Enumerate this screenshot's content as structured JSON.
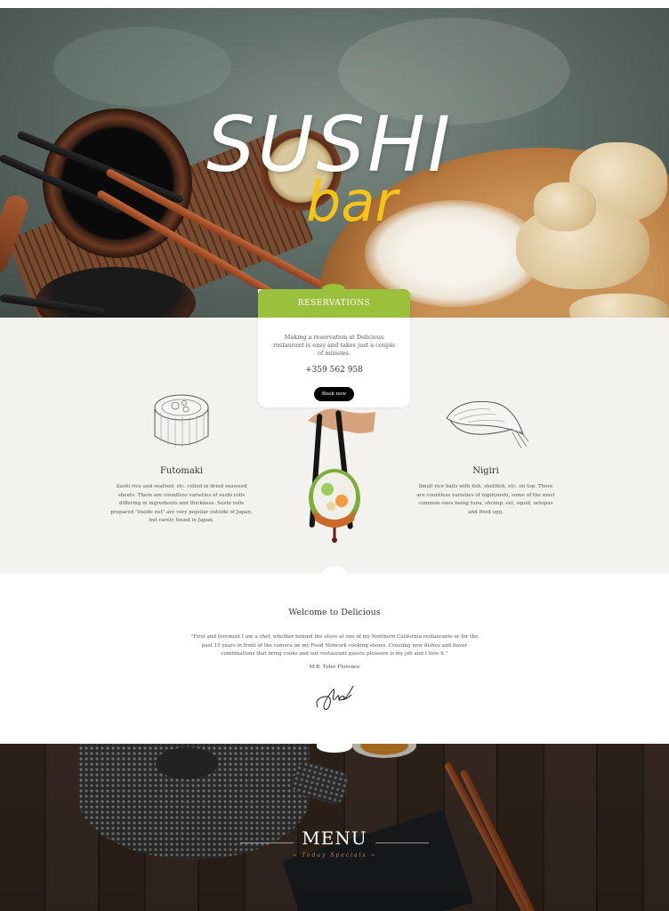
{
  "hero": {
    "logo_top": "SUSHI",
    "logo_bottom": "bar"
  },
  "reservations": {
    "title": "RESERVATIONS",
    "text": "Making a reservation at Delicious restaurant is easy and takes just a couple of minutes.",
    "phone": "+359 562 958",
    "button_label": "Book now"
  },
  "features": [
    {
      "title": "Futomaki",
      "text": "Sushi rice and seafood, etc. rolled in dried seaweed sheets. There are countless varieties of sushi rolls differing in ingredients and thickness. Sushi rolls prepared \"inside out\" are very popular outside of Japan, but rarely found in Japan.",
      "icon": "futomaki-sketch-icon"
    },
    {
      "title": "Nigiri",
      "text": "Small rice balls with fish, shellfish, etc. on top. There are countless varieties of nigirizushi, some of the most common ones being tuna, shrimp, eel, squid, octopus and fried egg.",
      "icon": "nigiri-sketch-icon"
    }
  ],
  "welcome": {
    "title": "Welcome to Delicious",
    "quote": "\"First and foremost I am a chef, whether behind the stove at one of my Northern California restaurants or for the past 15 years in front of the camera on my Food Network cooking shows. Creating new dishes and flavor combinations that bring cooks and our restaurant guests pleasure is my job and I love it.\"",
    "author": "M.R. Tyler Florence"
  },
  "menu": {
    "title": "MENU",
    "subtitle": "~ Today Specials ~"
  },
  "colors": {
    "accent_green": "#9bc13c",
    "logo_yellow": "#f5c417",
    "intro_bg": "#f3f2ef"
  }
}
